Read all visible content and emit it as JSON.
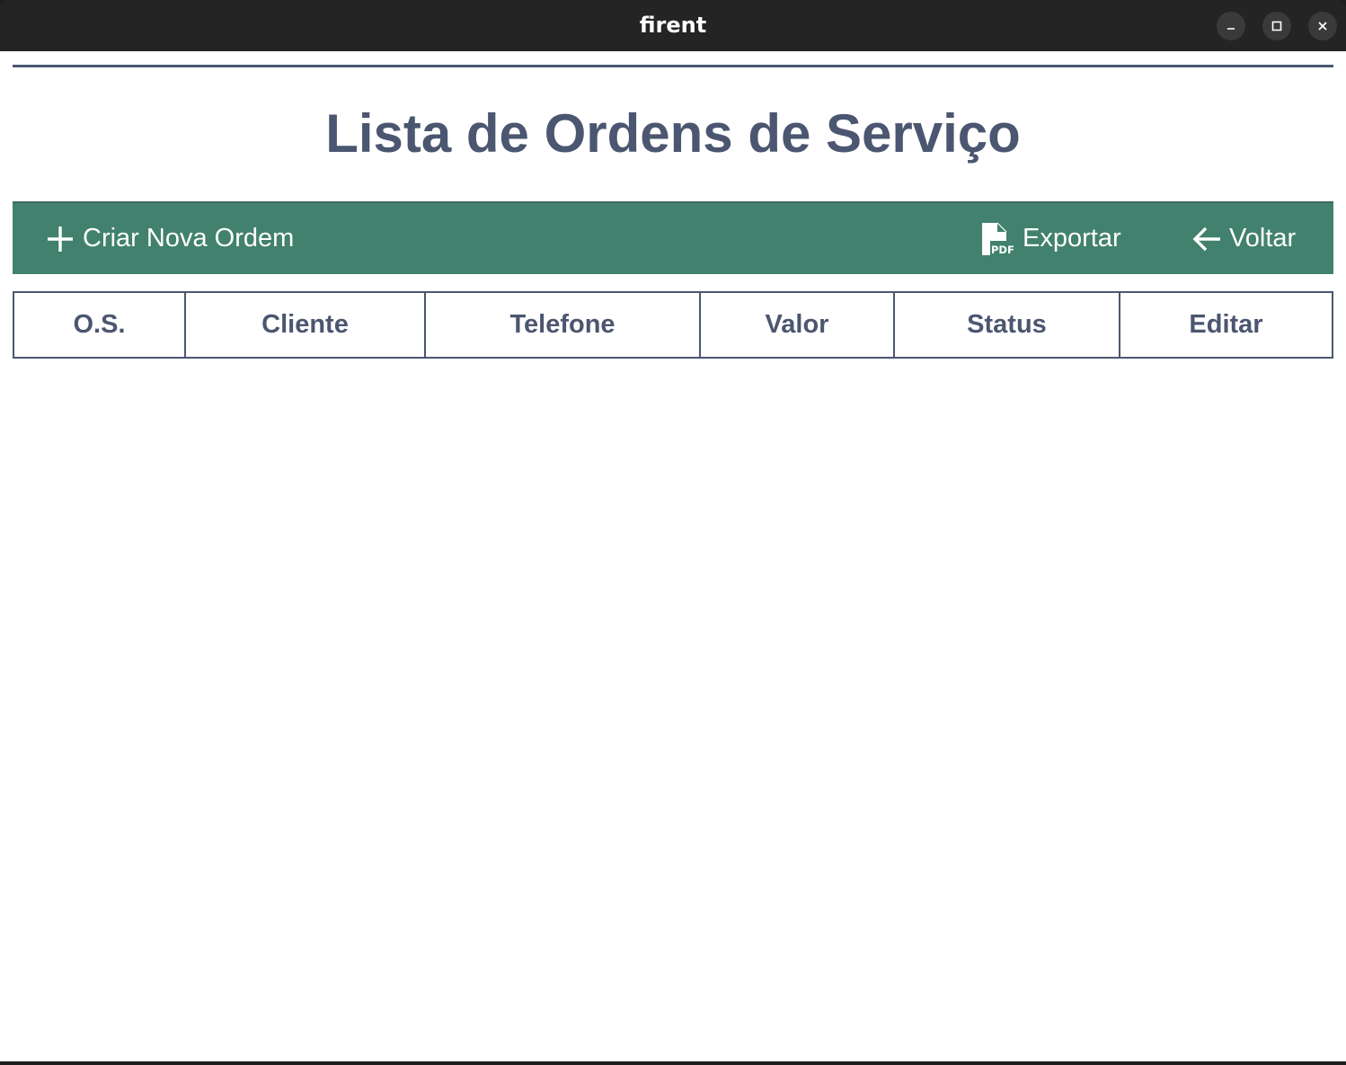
{
  "window": {
    "title": "firent",
    "controls": [
      "minimize-icon",
      "maximize-icon",
      "close-icon"
    ]
  },
  "page": {
    "title": "Lista de Ordens de Serviço"
  },
  "toolbar": {
    "background": "#41816d",
    "create_label": "Criar Nova Ordem",
    "create_icon": "plus-icon",
    "export_label": "Exportar",
    "export_icon": "pdf-file-icon",
    "back_label": "Voltar",
    "back_icon": "arrow-left-icon"
  },
  "table": {
    "columns": [
      "O.S.",
      "Cliente",
      "Telefone",
      "Valor",
      "Status",
      "Editar"
    ],
    "rows": []
  },
  "colors": {
    "text": "#4b5670",
    "accent": "#41816d",
    "titlebar": "#242424"
  }
}
